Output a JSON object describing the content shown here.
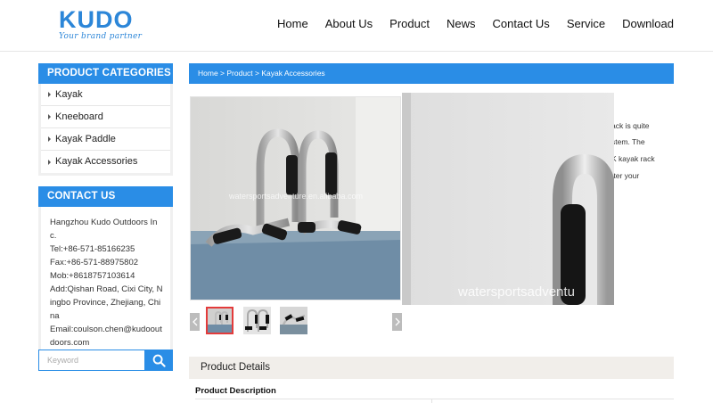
{
  "brand": {
    "name": "KUDO",
    "tagline": "Your brand partner",
    "color": "#2c86d8"
  },
  "nav": {
    "items": [
      "Home",
      "About Us",
      "Product",
      "News",
      "Contact Us",
      "Service",
      "Download"
    ]
  },
  "sidebar": {
    "categories_title": "PRODUCT CATEGORIES",
    "categories": [
      "Kayak",
      "Kneeboard",
      "Kayak Paddle",
      "Kayak Accessories"
    ],
    "contact_title": "CONTACT US",
    "contact": {
      "company": "Hangzhou Kudo Outdoors Inc.",
      "tel": "Tel:+86-571-85166235",
      "fax": "Fax:+86-571-88975802",
      "mob": "Mob:+8618757103614",
      "add": "Add:Qishan Road, Cixi City, Ningbo Province, Zhejiang, China",
      "email": "Email:coulson.chen@kudooutdoors.com"
    },
    "search_placeholder": "Keyword"
  },
  "breadcrumb": "Home > Product > Kayak Accessories",
  "description_fragments": [
    "ack is quite",
    "stem. The",
    "K kayak rack",
    "tter your"
  ],
  "product_image": {
    "watermark": "watersportsadventure.en.alibaba.com"
  },
  "zoom_image": {
    "watermark": "watersportsadventu"
  },
  "details": {
    "tab": "Product Details",
    "subtitle": "Product Description"
  },
  "colors": {
    "accent": "#2a8de6",
    "thumb_active": "#e33b3b"
  }
}
